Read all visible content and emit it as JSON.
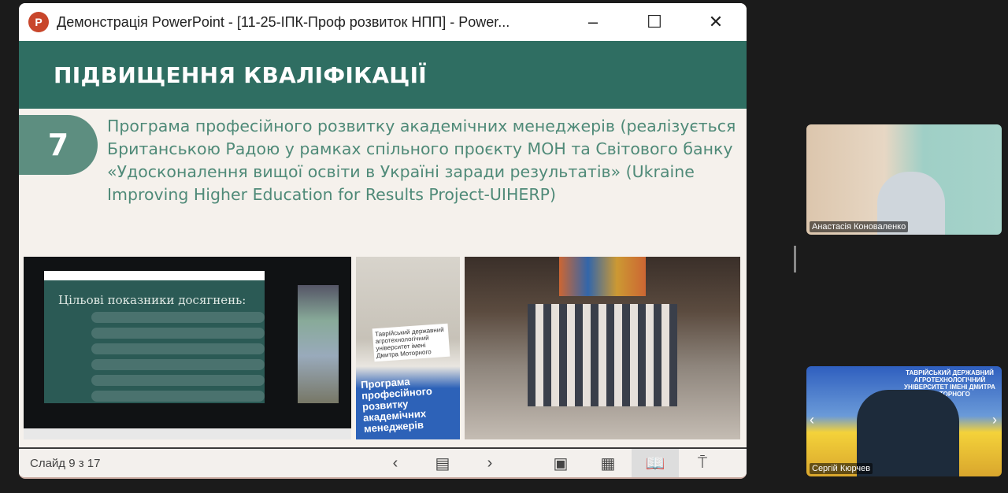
{
  "window": {
    "title": "Демонстрація PowerPoint - [11-25-ІПК-Проф розвиток НПП] - Power...",
    "minimize": "–",
    "maximize": "☐",
    "close": "✕",
    "app_icon": "P"
  },
  "slide": {
    "header": "ПІДВИЩЕННЯ КВАЛІФІКАЦІЇ",
    "number": "7",
    "description": "Програма професійного розвитку академічних менеджерів (реалізується Британською Радою у рамках спільного проєкту МОН та Світового банку «Удосконалення вищої освіти в Україні заради результатів» (Ukraine Improving Higher Education for Results Project-UIHERP)",
    "photo1_title": "Цільові показники досягнень:",
    "photo2_banner": "Програма професійного розвитку академічних менеджерів",
    "photo2_sign": "Таврійський державний агротехнологічний університет імені Дмитра Моторного"
  },
  "statusbar": {
    "slide_label": "Слайд 9 з 17",
    "prev": "‹",
    "notes": "▤",
    "next": "›",
    "normal": "▣",
    "sorter": "▦",
    "reading": "📖",
    "presenter": "⍑"
  },
  "participants": [
    {
      "name": "Анастасія Коноваленко"
    },
    {
      "name": "Сергій Кюрчев",
      "background_text": "ТАВРІЙСЬКИЙ ДЕРЖАВНИЙ АГРОТЕХНОЛОГІЧНИЙ УНІВЕРСИТЕТ ІМЕНІ ДМИТРА МОТОРНОГО"
    }
  ],
  "nav": {
    "left": "‹",
    "right": "›"
  }
}
